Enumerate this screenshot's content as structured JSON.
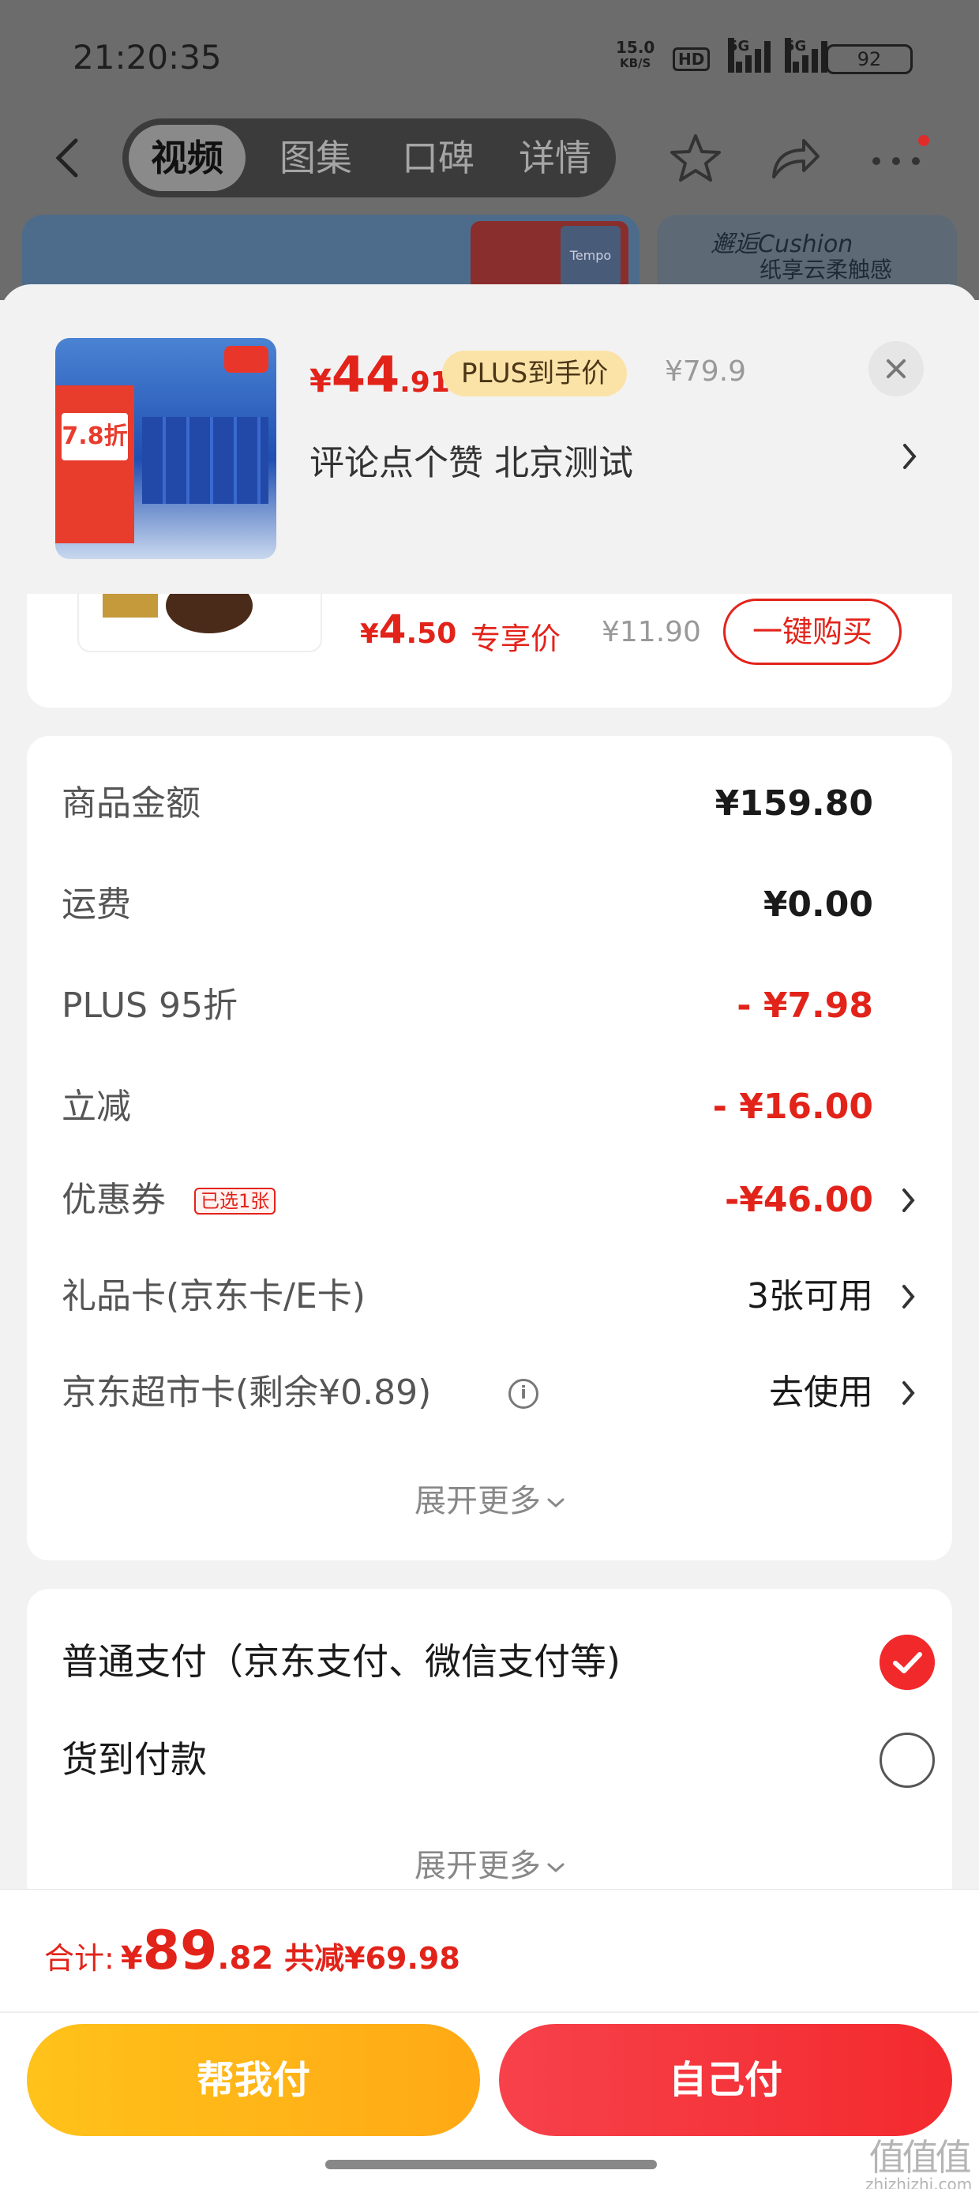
{
  "status_bar": {
    "time": "21:20:35",
    "net_speed_value": "15.0",
    "net_speed_unit": "KB/S",
    "hd_label": "HD",
    "sim1_label": "5G",
    "sim2_label": "5G",
    "battery": "92"
  },
  "nav": {
    "tabs": [
      "视频",
      "图集",
      "口碑",
      "详情"
    ],
    "active_tab": 0,
    "icons": [
      "back-icon",
      "star-icon",
      "share-icon",
      "more-icon"
    ]
  },
  "banners": {
    "right_line1": "邂逅Cushion",
    "right_line2": "纸享云柔触感"
  },
  "product": {
    "price_yen": "¥",
    "price_int": "44",
    "price_dec": ".91",
    "plus_label": "PLUS到手价",
    "original_price": "¥79.9",
    "title": "评论点个赞  北京测试",
    "thumb_discount": "7.8折"
  },
  "addon": {
    "price_yen": "¥",
    "price_int": "4",
    "price_dec": ".50",
    "tag": "专享价",
    "original_price": "¥11.90",
    "buy_label": "一键购买"
  },
  "breakdown": {
    "rows": [
      {
        "label": "商品金额",
        "value": "¥159.80"
      },
      {
        "label": "运费",
        "value": "¥0.00"
      },
      {
        "label": "PLUS 95折",
        "value": "- ¥7.98"
      },
      {
        "label": "立减",
        "value": "- ¥16.00"
      },
      {
        "label": "优惠券",
        "badge": "已选1张",
        "value": "-¥46.00"
      },
      {
        "label": "礼品卡(京东卡/E卡)",
        "value": "3张可用"
      },
      {
        "label": "京东超市卡(剩余¥0.89)",
        "value": "去使用"
      }
    ],
    "expand_label": "展开更多"
  },
  "payment": {
    "options": [
      {
        "label": "普通支付（京东支付、微信支付等)",
        "selected": true
      },
      {
        "label": "货到付款",
        "selected": false
      }
    ],
    "expand_label": "展开更多"
  },
  "footer": {
    "total_label": "合计:",
    "total_yen": "¥",
    "total_int": "89",
    "total_dec": ".82",
    "savings": "共减¥69.98",
    "help_pay": "帮我付",
    "self_pay": "自己付"
  },
  "watermark": {
    "big": "值值值",
    "small": "zhizhizhi.com"
  },
  "colors": {
    "price_red": "#e2231a",
    "plus_gold": "#fbe3a8",
    "help_btn": "#ffb316",
    "self_btn": "#f3343a"
  }
}
